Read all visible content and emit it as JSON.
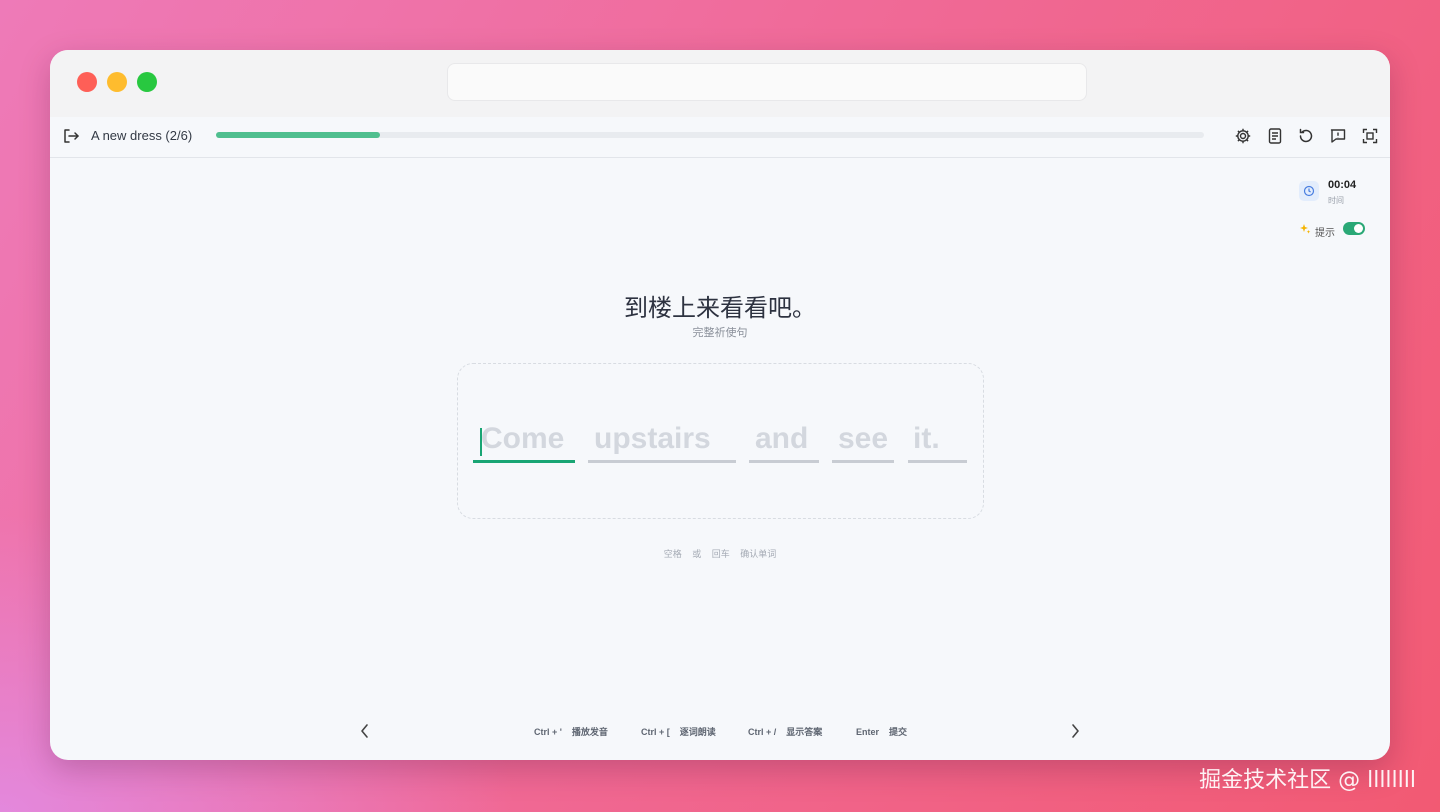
{
  "lesson": {
    "title": "A new dress (2/6)",
    "progress": 0.166
  },
  "side_panel": {
    "time_value": "00:04",
    "time_label": "时间",
    "hint_label": "提示",
    "hint_enabled": true
  },
  "prompt": {
    "sentence_cn": "到楼上来看看吧。",
    "subtitle": "完整祈使句"
  },
  "answer": {
    "words": [
      "Come",
      "upstairs",
      "and",
      "see",
      "it."
    ]
  },
  "tip": {
    "key1": "空格",
    "or": "或",
    "key2": "回车",
    "action": "确认单词"
  },
  "shortcuts": [
    {
      "key": "Ctrl + '",
      "label": "播放发音"
    },
    {
      "key": "Ctrl + [",
      "label": "逐词朗读"
    },
    {
      "key": "Ctrl + /",
      "label": "显示答案"
    },
    {
      "key": "Enter",
      "label": "提交"
    }
  ],
  "icons": {
    "exit": "exit-icon",
    "settings": "gear-icon",
    "notes": "notebook-icon",
    "reset": "refresh-icon",
    "feedback": "feedback-icon",
    "fullscreen": "fullscreen-icon",
    "clock": "clock-icon",
    "hint": "sparkle-icon",
    "prev": "chevron-left-icon",
    "next": "chevron-right-icon"
  },
  "colors": {
    "accent": "#19a574",
    "progress": "#4fbf8f"
  },
  "watermark": "掘金技术社区 @ llllllll"
}
